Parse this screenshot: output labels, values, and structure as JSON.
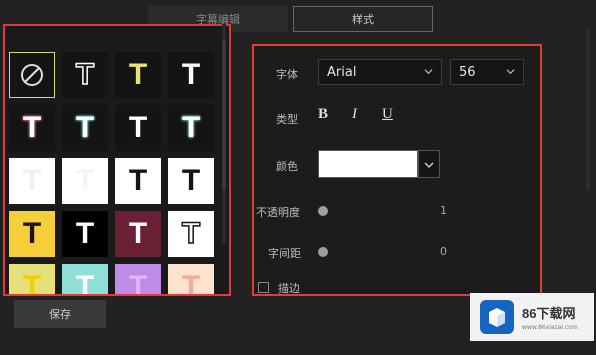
{
  "tabs": [
    {
      "label": "字幕编辑",
      "active": false
    },
    {
      "label": "样式",
      "active": true
    }
  ],
  "presets": [
    {
      "kind": "none",
      "bg": "#141414",
      "color": "#ffffff"
    },
    {
      "kind": "outline",
      "bg": "#141414",
      "color": "#141414",
      "stroke": "#ffffff",
      "glyph": "T"
    },
    {
      "kind": "fill",
      "bg": "#141414",
      "color": "#e8e27a",
      "glyph": "T"
    },
    {
      "kind": "fill",
      "bg": "#141414",
      "color": "#ffffff",
      "glyph": "T"
    },
    {
      "kind": "glow",
      "bg": "#141414",
      "color": "#ffffff",
      "glow": "#e879b7",
      "glyph": "T"
    },
    {
      "kind": "glow",
      "bg": "#141414",
      "color": "#ffffff",
      "glow": "#7fe0c8",
      "glyph": "T"
    },
    {
      "kind": "fill",
      "bg": "#141414",
      "color": "#ffffff",
      "glyph": "T"
    },
    {
      "kind": "glow",
      "bg": "#141414",
      "color": "#ffffff",
      "glow": "#7fe0c8",
      "glyph": "T"
    },
    {
      "kind": "fill",
      "bg": "#ffffff",
      "color": "#f0f0f0",
      "glyph": "T"
    },
    {
      "kind": "fill",
      "bg": "#ffffff",
      "color": "#f5f5f5",
      "glyph": "T"
    },
    {
      "kind": "fill",
      "bg": "#ffffff",
      "color": "#141414",
      "glyph": "T"
    },
    {
      "kind": "fill",
      "bg": "#ffffff",
      "color": "#141414",
      "glyph": "T"
    },
    {
      "kind": "fill",
      "bg": "#f5cf3a",
      "color": "#141414",
      "glyph": "T"
    },
    {
      "kind": "fill",
      "bg": "#000000",
      "color": "#ffffff",
      "glyph": "T"
    },
    {
      "kind": "fill",
      "bg": "#6b2135",
      "color": "#ffffff",
      "glyph": "T"
    },
    {
      "kind": "outline",
      "bg": "#ffffff",
      "color": "#ffffff",
      "stroke": "#141414",
      "glyph": "T"
    },
    {
      "kind": "fill",
      "bg": "#e6e07a",
      "color": "#f0d000",
      "glyph": "T"
    },
    {
      "kind": "fill",
      "bg": "#8fe0d8",
      "color": "#ffffff",
      "glyph": "T"
    },
    {
      "kind": "fill",
      "bg": "#c08ae8",
      "color": "#e5b0ff",
      "glyph": "T"
    },
    {
      "kind": "fill",
      "bg": "#fde3cf",
      "color": "#f4a9a0",
      "glyph": "T"
    }
  ],
  "save_label": "保存",
  "style": {
    "font_label": "字体",
    "font_value": "Arial",
    "size_value": "56",
    "type_label": "类型",
    "bold": "B",
    "italic": "I",
    "underline": "U",
    "color_label": "颜色",
    "color_value": "#ffffff",
    "opacity_label": "不透明度",
    "opacity_value": "1",
    "spacing_label": "字间距",
    "spacing_value": "0",
    "stroke_label": "描边"
  },
  "watermark": {
    "title": "86下载网",
    "sub": "www.86xiazai.com"
  }
}
